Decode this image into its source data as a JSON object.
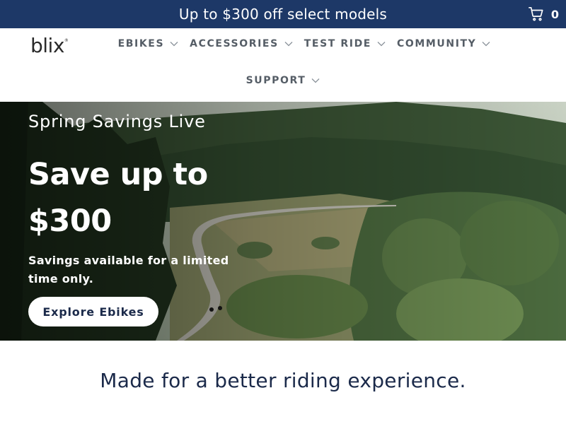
{
  "announcement": {
    "text": "Up to $300 off select models",
    "cart_count": "0",
    "cart_icon": "cart-icon"
  },
  "header": {
    "logo": "blix",
    "nav": [
      {
        "label": "EBIKES",
        "icon": "chevron-down-icon"
      },
      {
        "label": "ACCESSORIES",
        "icon": "chevron-down-icon"
      },
      {
        "label": "TEST RIDE",
        "icon": "chevron-down-icon"
      },
      {
        "label": "COMMUNITY",
        "icon": "chevron-down-icon"
      },
      {
        "label": "SUPPORT",
        "icon": "chevron-down-icon"
      }
    ]
  },
  "hero": {
    "eyebrow": "Spring Savings Live",
    "headline": "Save up to $300",
    "subtext": "Savings available for a limited time only.",
    "cta_label": "Explore Ebikes"
  },
  "section": {
    "tagline": "Made for a better riding experience."
  },
  "colors": {
    "announcement_bg": "#1d3867",
    "text_dark": "#1b2a4a",
    "nav_text": "#555d66"
  }
}
